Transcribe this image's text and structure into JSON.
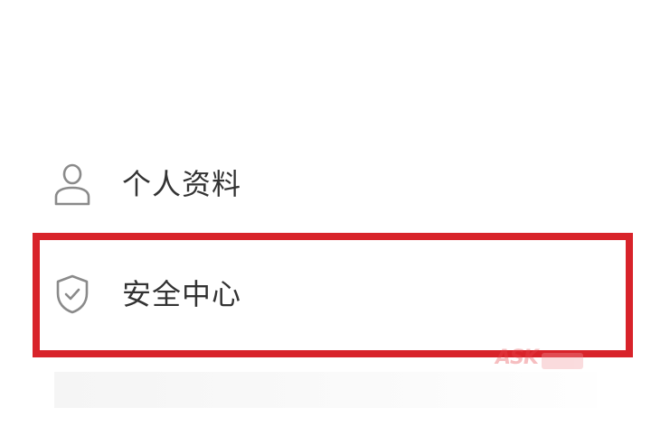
{
  "menu": {
    "items": [
      {
        "label": "个人资料",
        "icon": "user-icon"
      },
      {
        "label": "安全中心",
        "icon": "shield-check-icon"
      }
    ]
  },
  "highlight": {
    "color": "#d8232a",
    "target": "安全中心"
  },
  "watermark": {
    "text": "ASK"
  }
}
